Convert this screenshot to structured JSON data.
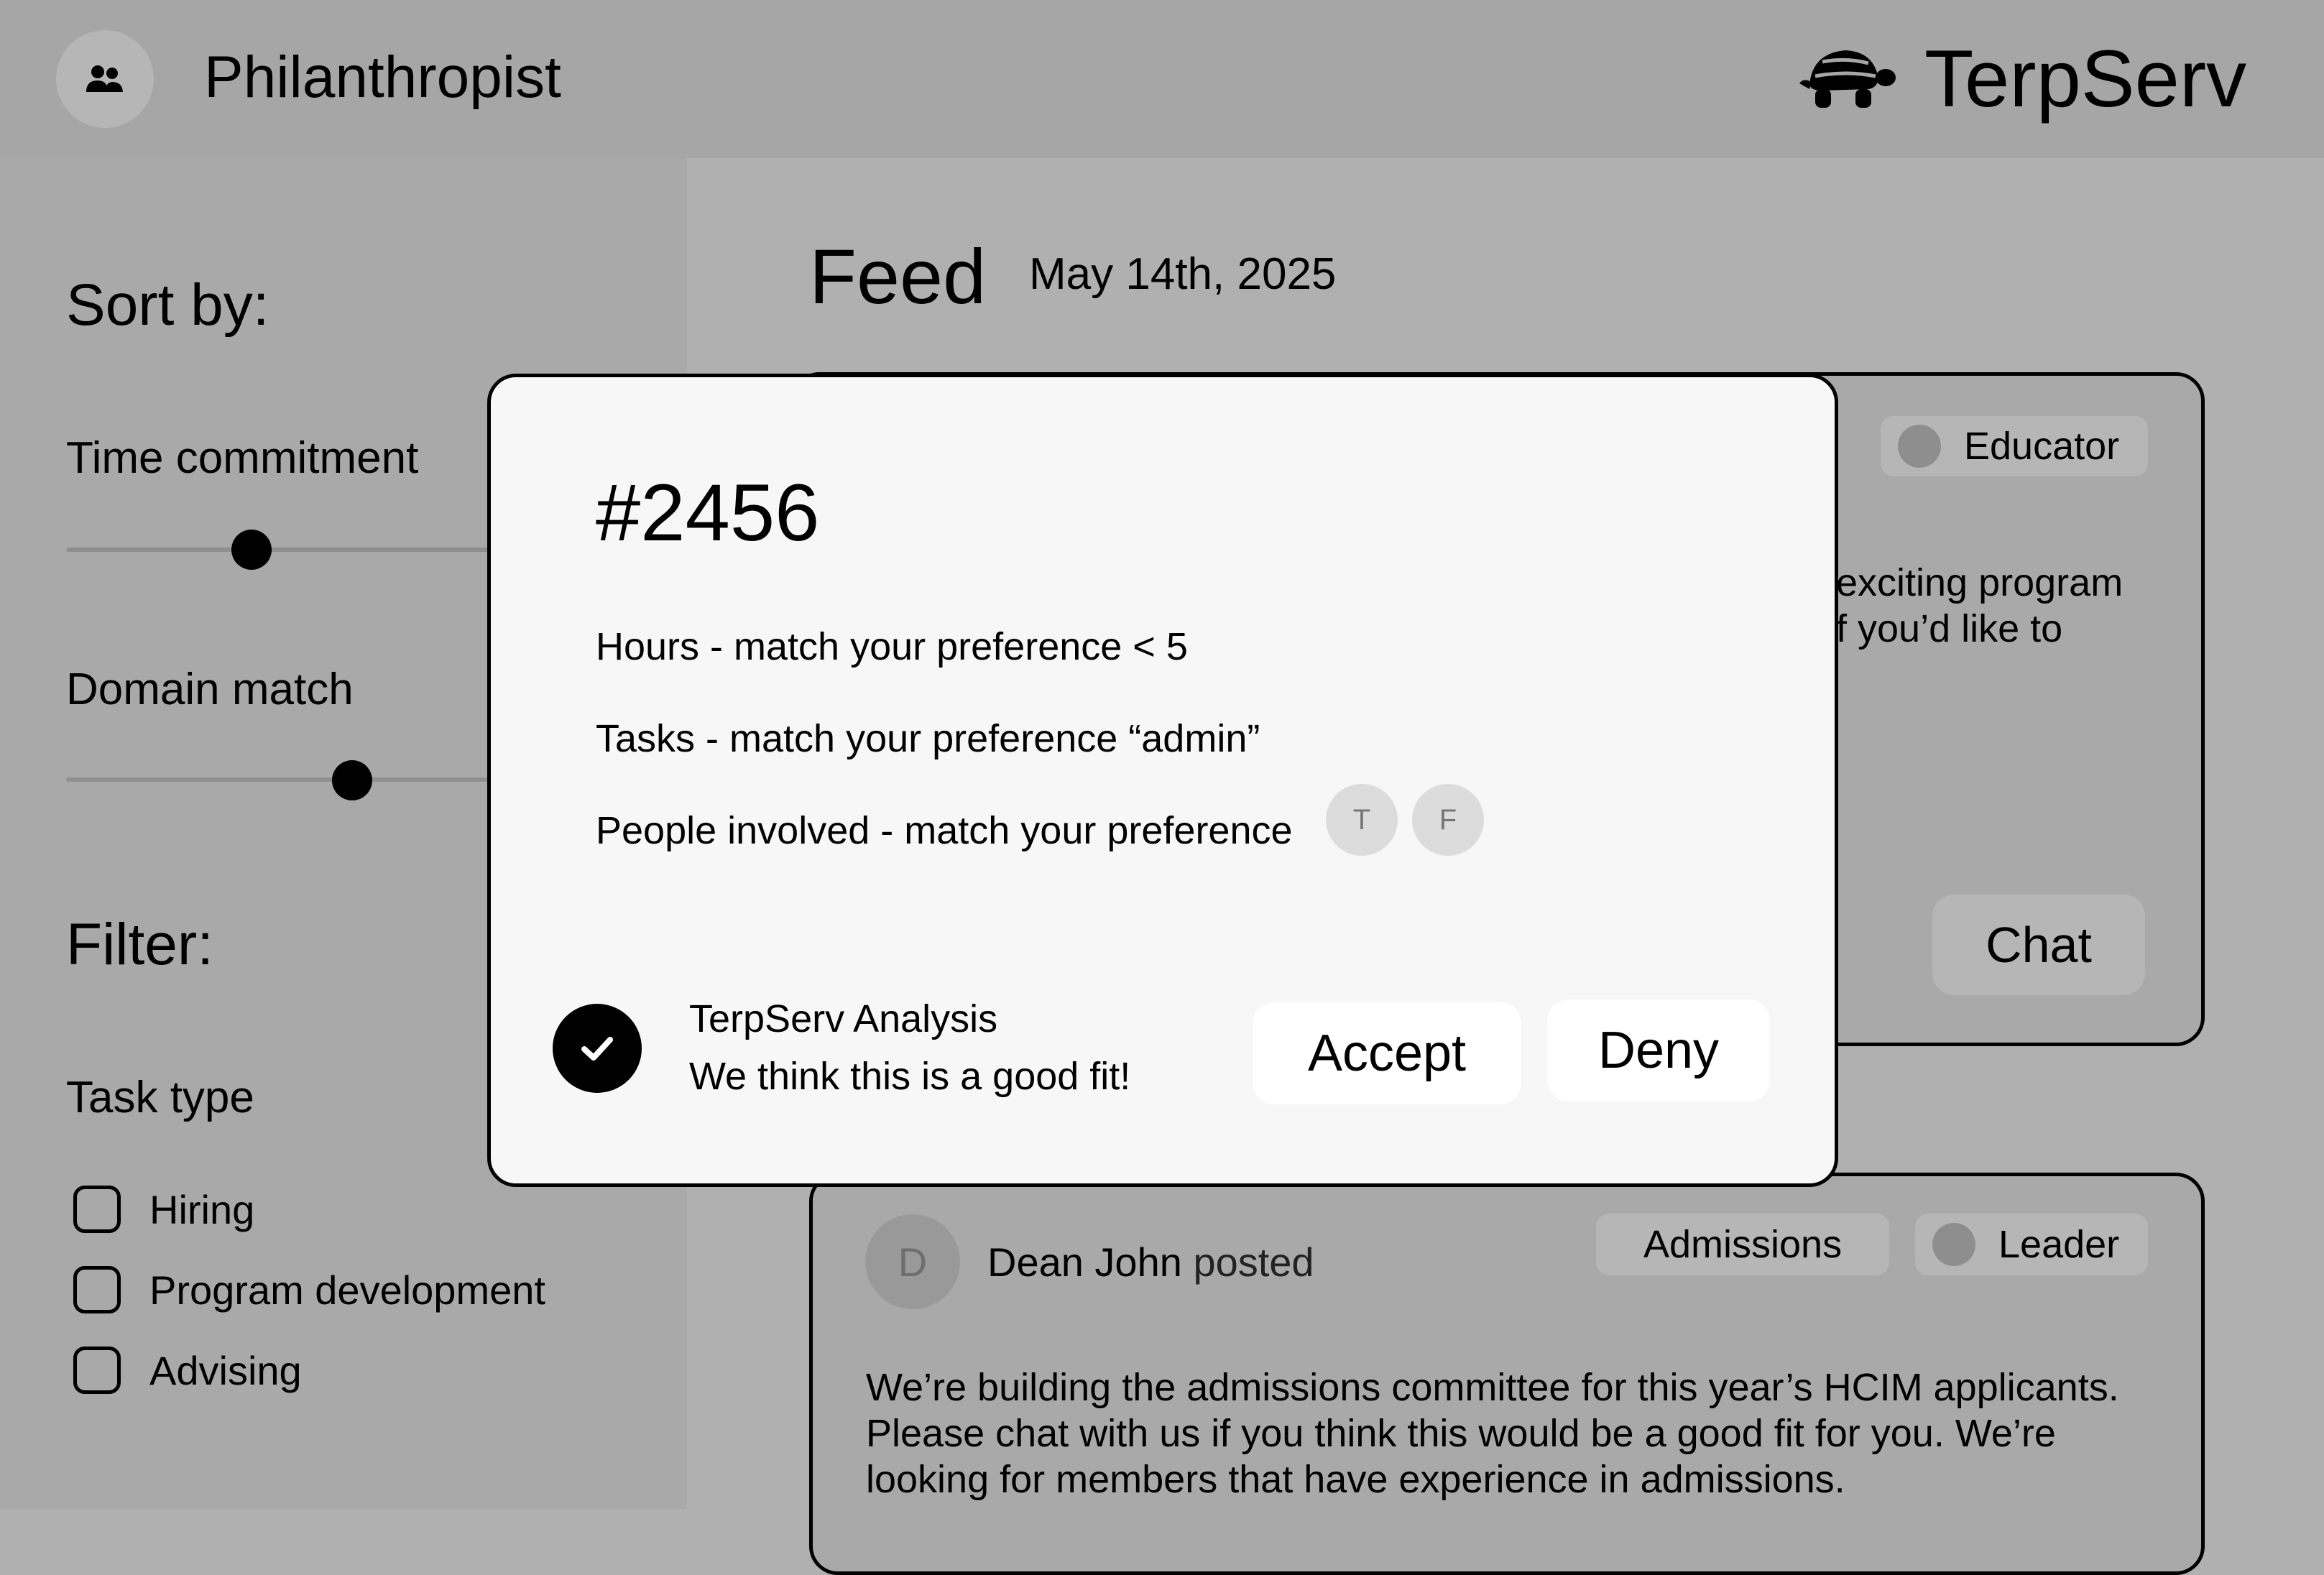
{
  "header": {
    "role_title": "Philanthropist",
    "role_icon": "people-icon",
    "brand": "TerpServ",
    "brand_icon": "turtle-icon"
  },
  "sidebar": {
    "sort_title": "Sort by:",
    "sliders": [
      {
        "label": "Time commitment",
        "value_fraction": 0.18
      },
      {
        "label": "Domain match",
        "value_fraction": 0.28
      }
    ],
    "filter_title": "Filter:",
    "task_type_title": "Task type",
    "task_types": [
      {
        "label": "Hiring",
        "checked": false
      },
      {
        "label": "Program development",
        "checked": false
      },
      {
        "label": "Advising",
        "checked": false
      }
    ]
  },
  "feed": {
    "title": "Feed",
    "date": "May 14th, 2025",
    "posts": [
      {
        "tags": [
          "Educator"
        ],
        "body_visible_lines": [
          "exciting program",
          "f you’d like to"
        ],
        "chat_label": "Chat"
      },
      {
        "avatar_initial": "D",
        "author": "Dean John",
        "verb": "posted",
        "tags": [
          "Admissions",
          "Leader"
        ],
        "body_lines": [
          "We’re building the admissions committee for this year’s HCIM applicants.",
          "Please chat with us if you think this would be a good fit for you. We’re",
          "looking for members that have experience in admissions."
        ]
      }
    ]
  },
  "modal": {
    "id": "#2456",
    "matches": [
      "Hours - match your preference < 5",
      "Tasks - match your preference “admin”",
      "People involved - match your preference"
    ],
    "people_initials": [
      "T",
      "F"
    ],
    "analysis_title": "TerpServ Analysis",
    "analysis_text": "We think this is a good fit!",
    "accept_label": "Accept",
    "deny_label": "Deny"
  },
  "colors": {
    "background": "#b0b0b0",
    "header_bg": "#a6a6a6",
    "modal_bg": "#f7f7f7",
    "tag_bg": "#b6b6b6"
  }
}
